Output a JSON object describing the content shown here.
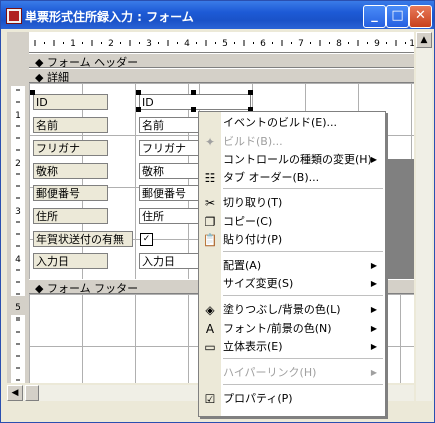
{
  "window": {
    "title": "単票形式住所録入力 : フォーム"
  },
  "titlebar_buttons": [
    "minimize-icon",
    "maximize-icon",
    "close-icon"
  ],
  "ruler": {
    "top_ticks": [
      "1",
      "2",
      "3",
      "4",
      "5",
      "6",
      "7",
      "8",
      "9",
      "10"
    ],
    "left_ticks": [
      "1",
      "2",
      "3",
      "4",
      "5"
    ]
  },
  "sections": {
    "header": "フォーム ヘッダー",
    "detail": "詳細",
    "footer": "フォーム フッター"
  },
  "fields": [
    {
      "label": "ID",
      "value": "ID"
    },
    {
      "label": "名前",
      "value": "名前"
    },
    {
      "label": "フリガナ",
      "value": "フリガナ"
    },
    {
      "label": "敬称",
      "value": "敬称"
    },
    {
      "label": "郵便番号",
      "value": "郵便番号"
    },
    {
      "label": "住所",
      "value": "住所"
    },
    {
      "label": "年賀状送付の有無",
      "value": "✓"
    },
    {
      "label": "入力日",
      "value": "入力日"
    }
  ],
  "context_menu": {
    "items": [
      {
        "label": "イベントのビルド(E)...",
        "icon": "",
        "enabled": true,
        "submenu": false
      },
      {
        "label": "ビルド(B)...",
        "icon": "build-icon",
        "enabled": false,
        "submenu": false
      },
      {
        "label": "コントロールの種類の変更(H)",
        "icon": "",
        "enabled": true,
        "submenu": true
      },
      {
        "label": "タブ オーダー(B)...",
        "icon": "tab-order-icon",
        "enabled": true,
        "submenu": false
      },
      {
        "label": "切り取り(T)",
        "icon": "scissors-icon",
        "enabled": true,
        "submenu": false
      },
      {
        "label": "コピー(C)",
        "icon": "copy-icon",
        "enabled": true,
        "submenu": false
      },
      {
        "label": "貼り付け(P)",
        "icon": "paste-icon",
        "enabled": true,
        "submenu": false
      },
      {
        "label": "配置(A)",
        "icon": "",
        "enabled": true,
        "submenu": true
      },
      {
        "label": "サイズ変更(S)",
        "icon": "",
        "enabled": true,
        "submenu": true
      },
      {
        "label": "塗りつぶし/背景の色(L)",
        "icon": "fill-color-icon",
        "enabled": true,
        "submenu": true
      },
      {
        "label": "フォント/前景の色(N)",
        "icon": "font-color-icon",
        "enabled": true,
        "submenu": true
      },
      {
        "label": "立体表示(E)",
        "icon": "effect-icon",
        "enabled": true,
        "submenu": true
      },
      {
        "label": "ハイパーリンク(H)",
        "icon": "",
        "enabled": false,
        "submenu": true
      },
      {
        "label": "プロパティ(P)",
        "icon": "properties-icon",
        "enabled": true,
        "submenu": false
      }
    ]
  },
  "colors": {
    "titlebar": "#1d5ad6",
    "grid_background": "#ffffff",
    "section_bar": "#d4d0c8",
    "menu_background": "#ffffff"
  }
}
